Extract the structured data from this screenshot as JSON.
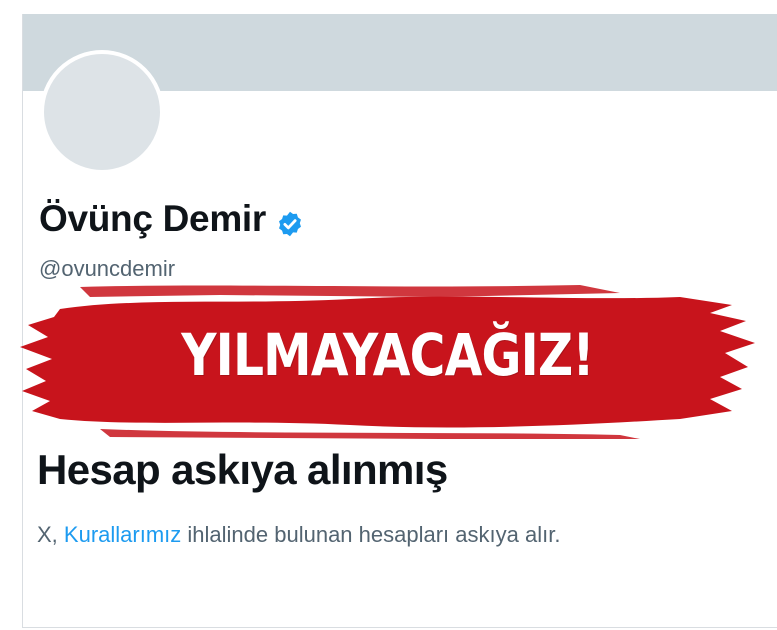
{
  "profile": {
    "display_name": "Övünç Demir",
    "handle": "@ovuncdemir",
    "verified_color": "#1d9bf0"
  },
  "stamp": {
    "text": "YILMAYACAĞIZ!",
    "color": "#c8141c"
  },
  "suspension": {
    "heading": "Hesap askıya alınmış",
    "desc_prefix": "X,",
    "desc_link": "Kurallarımız",
    "desc_suffix": "ihlalinde bulunan hesapları askıya alır."
  },
  "colors": {
    "banner": "#cfd9de",
    "text_primary": "#0f1419",
    "text_secondary": "#536471",
    "link": "#1d9bf0"
  }
}
